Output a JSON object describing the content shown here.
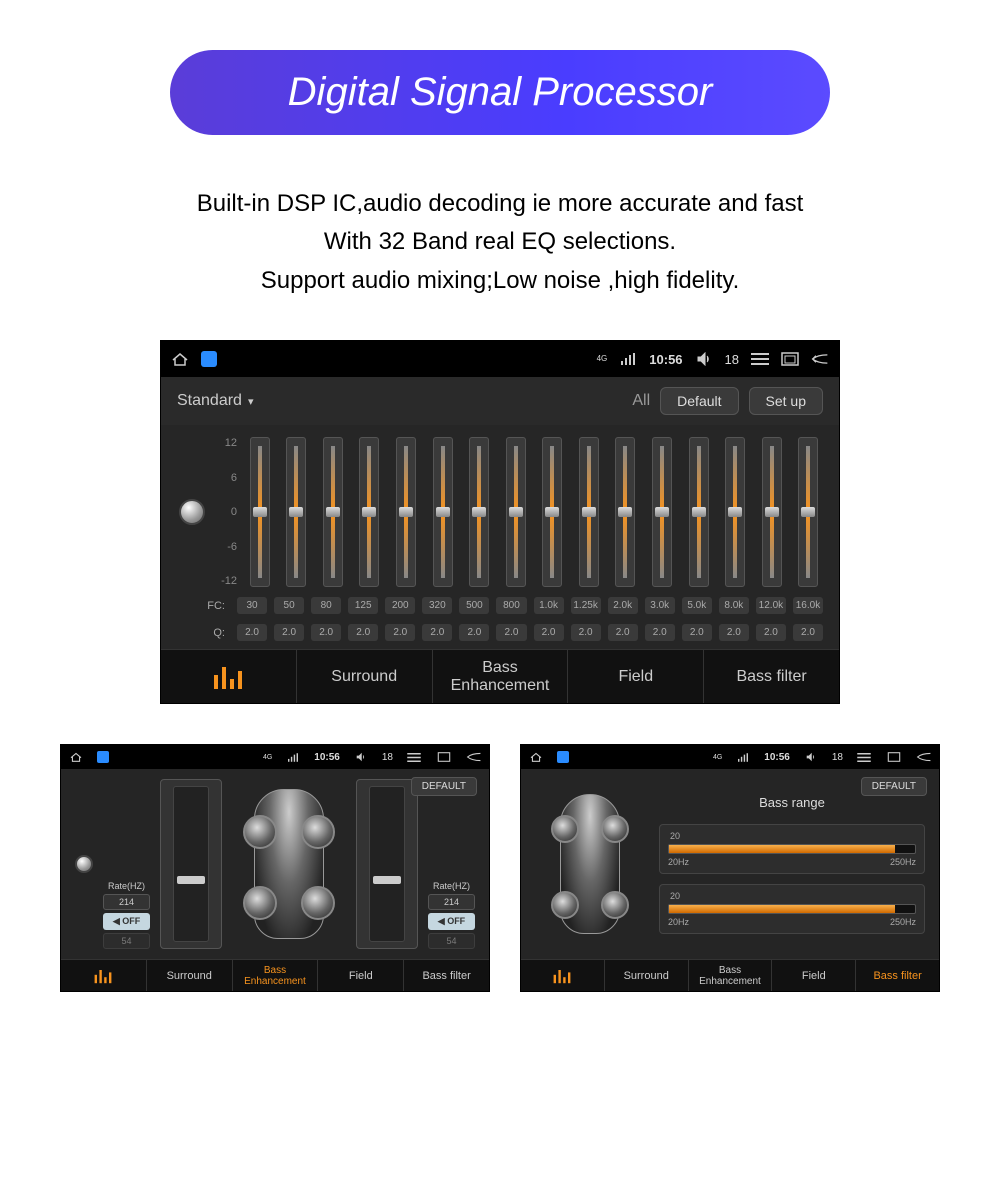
{
  "title": "Digital Signal Processor",
  "description": {
    "line1": "Built-in DSP IC,audio decoding ie more accurate and fast",
    "line2": "With 32 Band real EQ selections.",
    "line3": "Support audio mixing;Low noise ,high fidelity."
  },
  "statusbar": {
    "net_label": "4G",
    "time": "10:56",
    "indicator": "18"
  },
  "main_eq": {
    "preset": "Standard",
    "header": {
      "all": "All",
      "default": "Default",
      "setup": "Set up"
    },
    "db_labels": [
      "12",
      "6",
      "0",
      "-6",
      "-12"
    ],
    "fc_label": "FC:",
    "q_label": "Q:",
    "bands": [
      {
        "fc": "30",
        "q": "2.0"
      },
      {
        "fc": "50",
        "q": "2.0"
      },
      {
        "fc": "80",
        "q": "2.0"
      },
      {
        "fc": "125",
        "q": "2.0"
      },
      {
        "fc": "200",
        "q": "2.0"
      },
      {
        "fc": "320",
        "q": "2.0"
      },
      {
        "fc": "500",
        "q": "2.0"
      },
      {
        "fc": "800",
        "q": "2.0"
      },
      {
        "fc": "1.0k",
        "q": "2.0"
      },
      {
        "fc": "1.25k",
        "q": "2.0"
      },
      {
        "fc": "2.0k",
        "q": "2.0"
      },
      {
        "fc": "3.0k",
        "q": "2.0"
      },
      {
        "fc": "5.0k",
        "q": "2.0"
      },
      {
        "fc": "8.0k",
        "q": "2.0"
      },
      {
        "fc": "12.0k",
        "q": "2.0"
      },
      {
        "fc": "16.0k",
        "q": "2.0"
      }
    ]
  },
  "bottom_tabs": {
    "eq": "",
    "surround": "Surround",
    "bass_enh": "Bass Enhancement",
    "field": "Field",
    "bass_filter": "Bass filter"
  },
  "field_panel": {
    "default": "DEFAULT",
    "rate_label": "Rate(HZ)",
    "rate_value": "214",
    "off_label": "◀ OFF",
    "dim_value": "54"
  },
  "bass_panel": {
    "default": "DEFAULT",
    "title": "Bass range",
    "sliders": [
      {
        "top": "20",
        "min": "20Hz",
        "max": "250Hz"
      },
      {
        "top": "20",
        "min": "20Hz",
        "max": "250Hz"
      }
    ]
  }
}
